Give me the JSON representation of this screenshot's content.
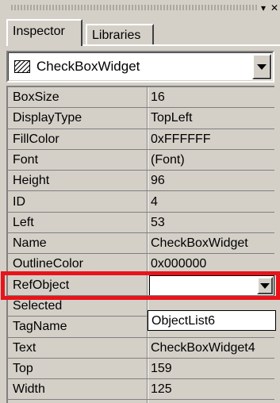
{
  "titlebar": {
    "pin_icon": "pin-icon",
    "close_icon": "close-icon"
  },
  "tabs": [
    {
      "label": "Inspector",
      "active": true
    },
    {
      "label": "Libraries",
      "active": false
    }
  ],
  "object_selector": {
    "icon": "widget-icon",
    "value": "CheckBoxWidget"
  },
  "properties": [
    {
      "name": "BoxSize",
      "value": "16"
    },
    {
      "name": "DisplayType",
      "value": "TopLeft"
    },
    {
      "name": "FillColor",
      "value": "0xFFFFFF"
    },
    {
      "name": "Font",
      "value": "(Font)"
    },
    {
      "name": "Height",
      "value": "96"
    },
    {
      "name": "ID",
      "value": "4"
    },
    {
      "name": "Left",
      "value": "53"
    },
    {
      "name": "Name",
      "value": "CheckBoxWidget"
    },
    {
      "name": "OutlineColor",
      "value": "0x000000"
    },
    {
      "name": "RefObject",
      "value": ""
    },
    {
      "name": "Selected",
      "value": ""
    },
    {
      "name": "TagName",
      "value": ""
    },
    {
      "name": "Text",
      "value": "CheckBoxWidget4"
    },
    {
      "name": "Top",
      "value": "159"
    },
    {
      "name": "Width",
      "value": "125"
    }
  ],
  "refobject_dropdown": {
    "options": [
      "ObjectList6"
    ]
  },
  "highlight_color": "#e8141b"
}
